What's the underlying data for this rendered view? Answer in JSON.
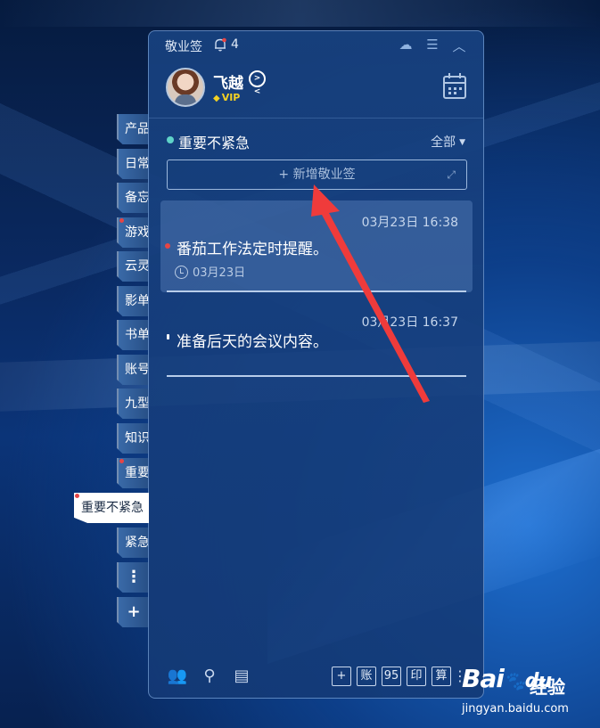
{
  "window": {
    "app_title": "敬业签",
    "notification_count": "4",
    "user": {
      "name": "飞越",
      "badge": "VIP"
    },
    "category": {
      "name": "重要不紧急",
      "filter": "全部"
    },
    "new_note_placeholder": "+ 新增敬业签",
    "notes": [
      {
        "time": "03月23日 16:38",
        "text": "番茄工作法定时提醒。",
        "reminder": "03月23日",
        "marker_color": "#e64545"
      },
      {
        "time": "03月23日 16:37",
        "text": "准备后天的会议内容。",
        "marker_color": "#ffffff"
      }
    ],
    "bottom_tools": [
      "+",
      "账",
      "95",
      "印",
      "算"
    ]
  },
  "side_tabs": [
    {
      "label": "产品",
      "flagged": false
    },
    {
      "label": "日常",
      "flagged": false
    },
    {
      "label": "备忘",
      "flagged": false
    },
    {
      "label": "游戏",
      "flagged": true
    },
    {
      "label": "云灵",
      "flagged": false
    },
    {
      "label": "影单",
      "flagged": false
    },
    {
      "label": "书单",
      "flagged": false
    },
    {
      "label": "账号",
      "flagged": false
    },
    {
      "label": "九型",
      "flagged": false
    },
    {
      "label": "知识",
      "flagged": false
    },
    {
      "label": "重要",
      "flagged": true
    },
    {
      "label": "重要不紧急",
      "flagged": true,
      "active": true
    },
    {
      "label": "紧急",
      "flagged": false
    },
    {
      "label": "⋮",
      "icon": true
    },
    {
      "label": "+",
      "icon": true
    }
  ],
  "watermark": {
    "logo": "Bai",
    "logo_paw": "du",
    "cn": "经验",
    "url": "jingyan.baidu.com"
  },
  "colors": {
    "accent_teal": "#5fd3c8",
    "alert_red": "#e64545",
    "arrow_red": "#ef3b3b",
    "vip_gold": "#f2d024"
  }
}
